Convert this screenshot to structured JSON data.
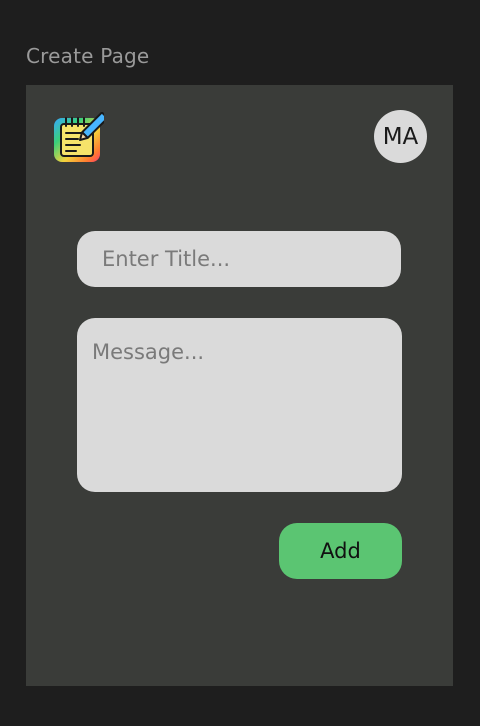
{
  "frame": {
    "label": "Create Page"
  },
  "header": {
    "logo_icon": "notepad-pencil-icon",
    "avatar_initials": "MA"
  },
  "form": {
    "title_placeholder": "Enter Title...",
    "title_value": "",
    "message_placeholder": "Message...",
    "message_value": "",
    "add_label": "Add"
  },
  "colors": {
    "page_background": "#1e1e1e",
    "frame_background": "#3a3c39",
    "input_background": "#dadada",
    "add_button": "#5bc572"
  }
}
